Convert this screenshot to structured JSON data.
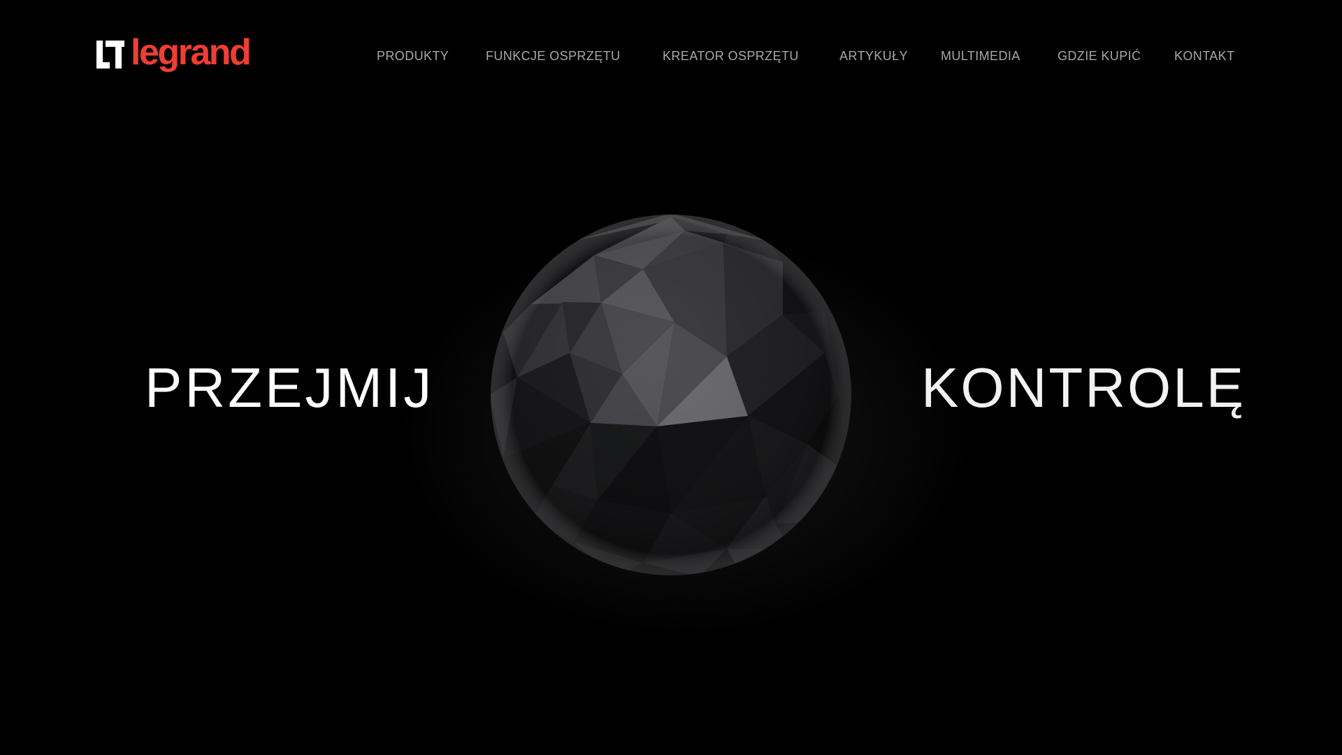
{
  "brand": {
    "logo_text": "legrand",
    "logo_color": "#ef3e33"
  },
  "nav": {
    "text_color": "#a8a8a8",
    "items": [
      {
        "label": "PRODUKTY"
      },
      {
        "label": "FUNKCJE OSPRZĘTU"
      },
      {
        "label": "KREATOR OSPRZĘTU"
      },
      {
        "label": "ARTYKUŁY"
      },
      {
        "label": "MULTIMEDIA"
      },
      {
        "label": "GDZIE KUPIĆ"
      },
      {
        "label": "KONTAKT"
      }
    ]
  },
  "hero": {
    "left_word": "PRZEJMIJ",
    "right_word": "KONTROLĘ",
    "text_color": "#ffffff",
    "background": "#000000",
    "centerpiece": "faceted-dark-sphere"
  }
}
